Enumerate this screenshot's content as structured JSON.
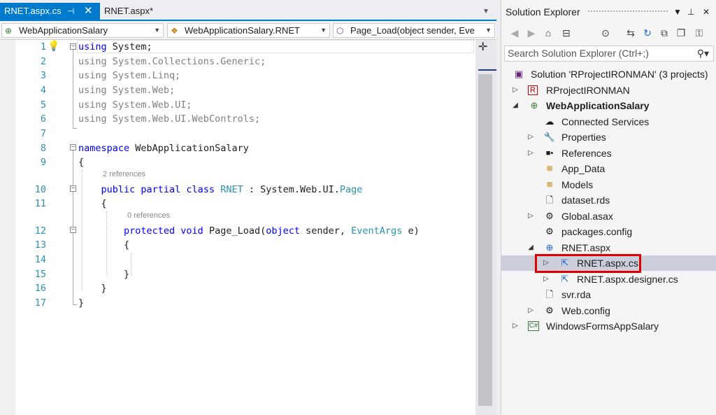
{
  "tabs": [
    {
      "label": "RNET.aspx.cs",
      "pin": "⊣",
      "close": "✕"
    },
    {
      "label": "RNET.aspx*"
    }
  ],
  "navbar": {
    "project": "WebApplicationSalary",
    "type": "WebApplicationSalary.RNET",
    "member": "Page_Load(object sender, Eve"
  },
  "code": {
    "line_numbers": [
      "1",
      "2",
      "3",
      "4",
      "5",
      "6",
      "7",
      "8",
      "9",
      "10",
      "11",
      "12",
      "13",
      "14",
      "15",
      "16",
      "17"
    ],
    "lines": [
      [
        {
          "t": "using",
          "c": "kw"
        },
        {
          "t": " System;",
          "c": ""
        }
      ],
      [
        {
          "t": "using",
          "c": "dim"
        },
        {
          "t": " System.Collections.Generic;",
          "c": "dim"
        }
      ],
      [
        {
          "t": "using",
          "c": "dim"
        },
        {
          "t": " System.Linq;",
          "c": "dim"
        }
      ],
      [
        {
          "t": "using",
          "c": "dim"
        },
        {
          "t": " System.Web;",
          "c": "dim"
        }
      ],
      [
        {
          "t": "using",
          "c": "dim"
        },
        {
          "t": " System.Web.UI;",
          "c": "dim"
        }
      ],
      [
        {
          "t": "using",
          "c": "dim"
        },
        {
          "t": " System.Web.UI.WebControls;",
          "c": "dim"
        }
      ],
      [],
      [
        {
          "t": "namespace",
          "c": "kw"
        },
        {
          "t": " WebApplicationSalary",
          "c": ""
        }
      ],
      [
        {
          "t": "{",
          "c": ""
        }
      ],
      [
        {
          "t": "    public partial class ",
          "c": "kw"
        },
        {
          "t": "RNET",
          "c": "ty"
        },
        {
          "t": " : System.Web.UI.",
          "c": ""
        },
        {
          "t": "Page",
          "c": "ty"
        }
      ],
      [
        {
          "t": "    {",
          "c": ""
        }
      ],
      [
        {
          "t": "        protected void ",
          "c": "kw"
        },
        {
          "t": "Page_Load(",
          "c": ""
        },
        {
          "t": "object",
          "c": "kw"
        },
        {
          "t": " sender, ",
          "c": ""
        },
        {
          "t": "EventArgs",
          "c": "ty"
        },
        {
          "t": " e)",
          "c": ""
        }
      ],
      [
        {
          "t": "        {",
          "c": ""
        }
      ],
      [],
      [
        {
          "t": "        }",
          "c": ""
        }
      ],
      [
        {
          "t": "    }",
          "c": ""
        }
      ],
      [
        {
          "t": "}",
          "c": ""
        }
      ]
    ],
    "ref_class": "2 references",
    "ref_method": "0 references"
  },
  "solution_explorer": {
    "title": "Solution Explorer",
    "search_placeholder": "Search Solution Explorer (Ctrl+;)",
    "items": [
      {
        "label": "Solution 'RProjectIRONMAN' (3 projects)"
      },
      {
        "label": "RProjectIRONMAN"
      },
      {
        "label": "WebApplicationSalary"
      },
      {
        "label": "Connected Services"
      },
      {
        "label": "Properties"
      },
      {
        "label": "References"
      },
      {
        "label": "App_Data"
      },
      {
        "label": "Models"
      },
      {
        "label": "dataset.rds"
      },
      {
        "label": "Global.asax"
      },
      {
        "label": "packages.config"
      },
      {
        "label": "RNET.aspx"
      },
      {
        "label": "RNET.aspx.cs"
      },
      {
        "label": "RNET.aspx.designer.cs"
      },
      {
        "label": "svr.rda"
      },
      {
        "label": "Web.config"
      },
      {
        "label": "WindowsFormsAppSalary"
      }
    ]
  },
  "colors": {
    "accent": "#007acc",
    "highlight": "#e00000",
    "keyword": "#0000ff",
    "type": "#2b91af"
  }
}
